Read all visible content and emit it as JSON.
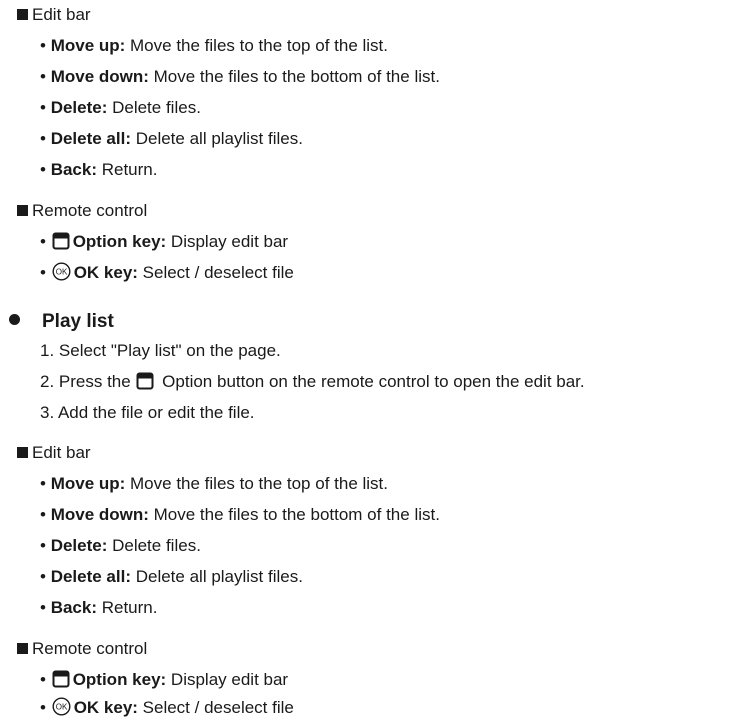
{
  "bullet_char": "•",
  "section1": {
    "edit_bar_heading": "Edit bar",
    "edit_items": [
      {
        "term": "Move up:",
        "desc": " Move the files to the top of the list."
      },
      {
        "term": "Move down:",
        "desc": " Move the files to the bottom of the list."
      },
      {
        "term": "Delete:",
        "desc": " Delete files."
      },
      {
        "term": "Delete all:",
        "desc": " Delete all playlist files."
      },
      {
        "term": "Back:",
        "desc": " Return."
      }
    ],
    "remote_heading": "Remote control",
    "remote_items": [
      {
        "icon": "option-key-icon",
        "term": "Option key:",
        "desc": " Display edit bar"
      },
      {
        "icon": "ok-key-icon",
        "term": "OK key:",
        "desc": " Select / deselect file"
      }
    ]
  },
  "play_list": {
    "title": "Play list",
    "steps": [
      "1. Select \"Play list\" on the page.",
      {
        "before": "2. Press the",
        "icon": "option-key-icon",
        "after": " Option button on the remote control to open the edit bar."
      },
      "3. Add the file or edit the file."
    ],
    "edit_bar_heading": "Edit bar",
    "edit_items": [
      {
        "term": "Move up:",
        "desc": " Move the files to the top of the list."
      },
      {
        "term": "Move down:",
        "desc": " Move the files to the bottom of the list."
      },
      {
        "term": "Delete:",
        "desc": " Delete files."
      },
      {
        "term": "Delete all:",
        "desc": " Delete all playlist files."
      },
      {
        "term": "Back:",
        "desc": " Return."
      }
    ],
    "remote_heading": "Remote control",
    "remote_items": [
      {
        "icon": "option-key-icon",
        "term": "Option key:",
        "desc": " Display edit bar"
      },
      {
        "icon": "ok-key-icon",
        "term": "OK key:",
        "desc": " Select / deselect file"
      }
    ],
    "ok_icon_label": "OK"
  }
}
